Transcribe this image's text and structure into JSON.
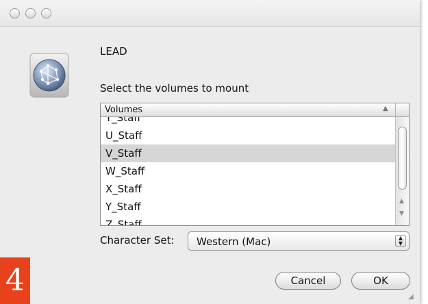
{
  "dialog": {
    "server_name": "LEAD",
    "prompt": "Select the volumes to mount"
  },
  "volumes": {
    "column_header": "Volumes",
    "rows": [
      {
        "label": "T_Staff"
      },
      {
        "label": "U_Staff"
      },
      {
        "label": "V_Staff",
        "selected": true
      },
      {
        "label": "W_Staff"
      },
      {
        "label": "X_Staff"
      },
      {
        "label": "Y_Staff"
      },
      {
        "label": "Z_Staff"
      }
    ]
  },
  "charset": {
    "label": "Character Set:",
    "value": "Western (Mac)"
  },
  "buttons": {
    "cancel": "Cancel",
    "ok": "OK"
  },
  "badge": {
    "text": "4",
    "color": "#e8421c"
  },
  "colors": {
    "selection": "#d6d6d6",
    "window_bg": "#ececec"
  },
  "icons": {
    "app": "network-globe-icon",
    "sort": "sort-ascending-icon"
  }
}
